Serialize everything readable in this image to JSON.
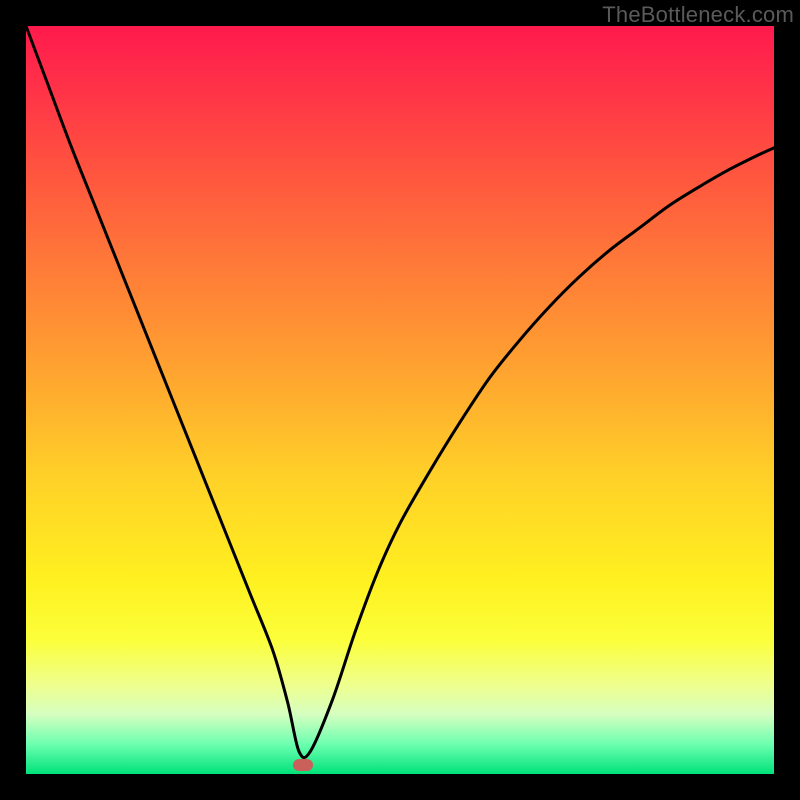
{
  "watermark": "TheBottleneck.com",
  "chart_data": {
    "type": "line",
    "title": "",
    "xlabel": "",
    "ylabel": "",
    "xlim": [
      0,
      100
    ],
    "ylim": [
      0,
      100
    ],
    "series": [
      {
        "name": "bottleneck-curve",
        "x": [
          0,
          3,
          6,
          9,
          12,
          15,
          18,
          21,
          24,
          27,
          30,
          33,
          35,
          36.5,
          38,
          41,
          44,
          47,
          50,
          54,
          58,
          62,
          66,
          70,
          74,
          78,
          82,
          86,
          90,
          94,
          98,
          100
        ],
        "values": [
          100,
          92,
          84,
          76.5,
          69,
          61.5,
          54,
          46.5,
          39,
          31.5,
          24,
          16.5,
          9.5,
          3.0,
          3.0,
          10.0,
          19.0,
          27.0,
          33.5,
          40.5,
          47.0,
          53.0,
          58.0,
          62.5,
          66.5,
          70.0,
          73.0,
          76.0,
          78.5,
          80.8,
          82.8,
          83.7
        ]
      }
    ],
    "marker": {
      "x": 37,
      "y": 1.2
    },
    "gradient_stops": [
      {
        "pos": 0,
        "color": "#ff1a4d"
      },
      {
        "pos": 74,
        "color": "#fff020"
      },
      {
        "pos": 100,
        "color": "#00e27a"
      }
    ]
  }
}
